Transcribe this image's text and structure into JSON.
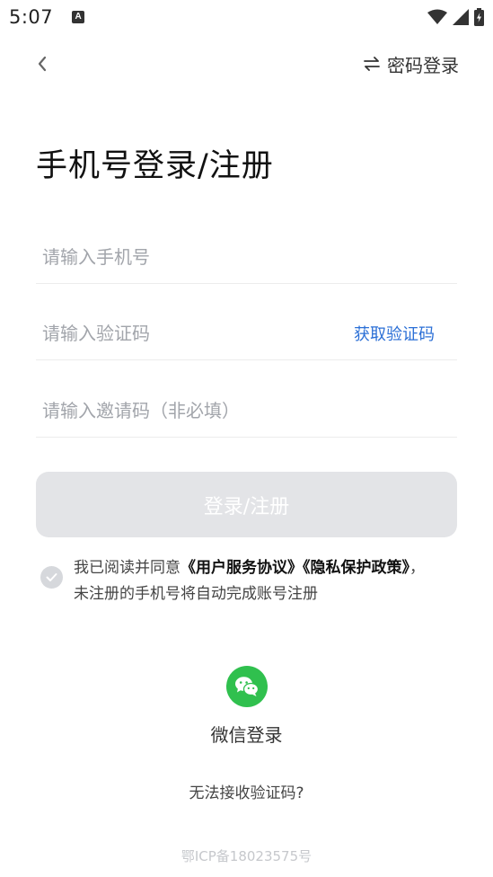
{
  "status_bar": {
    "time": "5:07",
    "notification_icon": "A"
  },
  "nav": {
    "back_icon": "chevron-left",
    "switch_label": "密码登录"
  },
  "title": "手机号登录/注册",
  "form": {
    "phone_placeholder": "请输入手机号",
    "code_placeholder": "请输入验证码",
    "get_code_label": "获取验证码",
    "invite_placeholder": "请输入邀请码（非必填）"
  },
  "login_button": "登录/注册",
  "agreement": {
    "prefix": "我已阅读并同意",
    "user_agreement": "《用户服务协议》",
    "privacy_policy": "《隐私保护政策》",
    "suffix": "，未注册的手机号将自动完成账号注册"
  },
  "wechat": {
    "label": "微信登录"
  },
  "cant_receive": "无法接收验证码?",
  "icp": "鄂ICP备18023575号",
  "colors": {
    "accent_link": "#2b6fd6",
    "wechat_green": "#30c04e",
    "disabled_button": "#e3e4e7"
  }
}
